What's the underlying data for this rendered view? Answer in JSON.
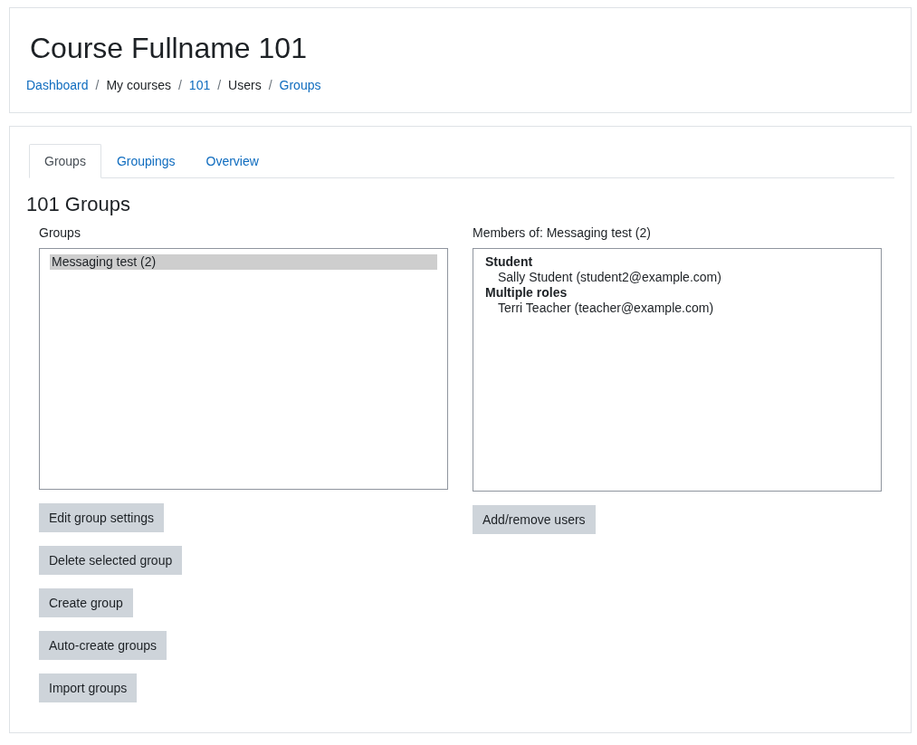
{
  "header": {
    "title": "Course Fullname 101",
    "breadcrumb": [
      {
        "label": "Dashboard",
        "link": true
      },
      {
        "label": "My courses",
        "link": false
      },
      {
        "label": "101",
        "link": true
      },
      {
        "label": "Users",
        "link": false
      },
      {
        "label": "Groups",
        "link": true
      }
    ],
    "separators": [
      "/",
      "/",
      "/",
      "/"
    ]
  },
  "tabs": [
    {
      "label": "Groups",
      "selected": true
    },
    {
      "label": "Groupings",
      "selected": false
    },
    {
      "label": "Overview",
      "selected": false
    }
  ],
  "heading": "101 Groups",
  "groups_panel": {
    "label": "Groups",
    "items": [
      {
        "label": "Messaging test (2)",
        "selected": true
      }
    ],
    "buttons": [
      "Edit group settings",
      "Delete selected group",
      "Create group",
      "Auto-create groups",
      "Import groups"
    ]
  },
  "members_panel": {
    "label": "Members of: Messaging test (2)",
    "sections": [
      {
        "role": "Student",
        "members": [
          "Sally Student (student2@example.com)"
        ]
      },
      {
        "role": "Multiple roles",
        "members": [
          "Terri Teacher (teacher@example.com)"
        ]
      }
    ],
    "buttons": [
      "Add/remove users"
    ]
  }
}
